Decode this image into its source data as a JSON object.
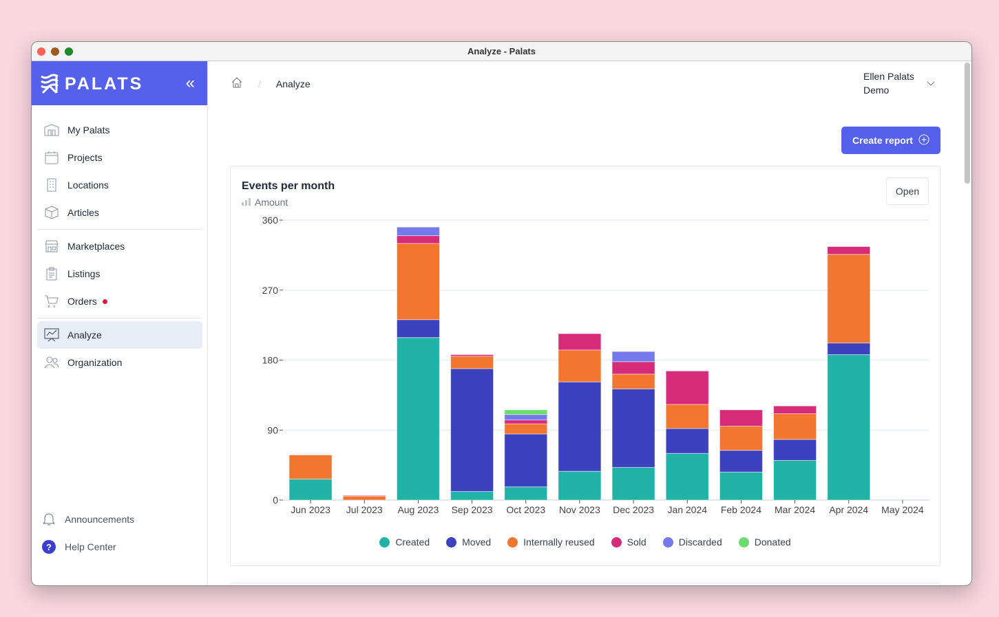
{
  "window": {
    "title": "Analyze - Palats"
  },
  "brand": {
    "name": "PALATS"
  },
  "sidebar": {
    "items": [
      {
        "label": "My Palats",
        "icon": "house-icon"
      },
      {
        "label": "Projects",
        "icon": "calendar-icon"
      },
      {
        "label": "Locations",
        "icon": "building-icon"
      },
      {
        "label": "Articles",
        "icon": "box-icon"
      },
      {
        "label": "Marketplaces",
        "icon": "store-icon"
      },
      {
        "label": "Listings",
        "icon": "clipboard-icon"
      },
      {
        "label": "Orders",
        "icon": "cart-icon"
      },
      {
        "label": "Analyze",
        "icon": "chart-icon"
      },
      {
        "label": "Organization",
        "icon": "users-icon"
      }
    ],
    "bottom": [
      {
        "label": "Announcements",
        "icon": "bell-icon"
      },
      {
        "label": "Help Center",
        "icon": "help-icon"
      }
    ]
  },
  "breadcrumb": {
    "current": "Analyze"
  },
  "user": {
    "name": "Ellen Palats",
    "org": "Demo"
  },
  "actions": {
    "create_report": "Create report"
  },
  "card": {
    "title": "Events per month",
    "subtitle": "Amount",
    "open": "Open"
  },
  "chart_data": {
    "type": "bar",
    "stacked": true,
    "categories": [
      "Jun 2023",
      "Jul 2023",
      "Aug 2023",
      "Sep 2023",
      "Oct 2023",
      "Nov 2023",
      "Dec 2023",
      "Jan 2024",
      "Feb 2024",
      "Mar 2024",
      "Apr 2024",
      "May 2024"
    ],
    "ylim": [
      0,
      360
    ],
    "yticks": [
      0,
      90,
      180,
      270,
      360
    ],
    "grid": true,
    "legend": "bottom",
    "series": [
      {
        "name": "Created",
        "color": "#20b2a6",
        "values": [
          27,
          0,
          209,
          11,
          17,
          37,
          42,
          60,
          36,
          51,
          187,
          0
        ]
      },
      {
        "name": "Moved",
        "color": "#3c41bd",
        "values": [
          0,
          0,
          23,
          158,
          68,
          115,
          101,
          32,
          28,
          27,
          15,
          0
        ]
      },
      {
        "name": "Internally reused",
        "color": "#f27530",
        "values": [
          31,
          5,
          98,
          16,
          13,
          41,
          19,
          31,
          31,
          33,
          114,
          0
        ]
      },
      {
        "name": "Sold",
        "color": "#d62b78",
        "values": [
          0,
          1,
          10,
          2,
          5,
          21,
          16,
          43,
          21,
          10,
          10,
          0
        ]
      },
      {
        "name": "Discarded",
        "color": "#7479ec",
        "values": [
          0,
          0,
          11,
          0,
          7,
          0,
          13,
          0,
          0,
          0,
          0,
          0
        ]
      },
      {
        "name": "Donated",
        "color": "#6cdb6c",
        "values": [
          0,
          0,
          0,
          0,
          6,
          0,
          0,
          0,
          0,
          0,
          0,
          0
        ]
      }
    ]
  }
}
